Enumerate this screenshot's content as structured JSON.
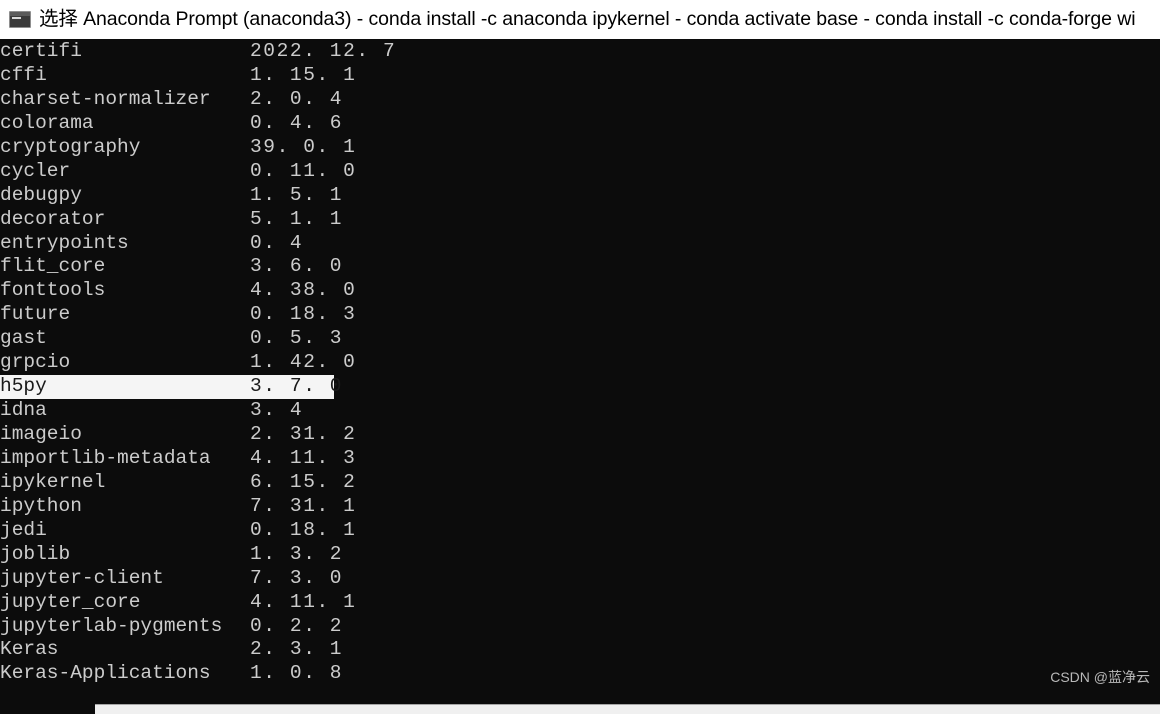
{
  "window": {
    "title": "选择 Anaconda Prompt (anaconda3) - conda  install -c anaconda ipykernel - conda  activate base - conda  install -c conda-forge wi",
    "icon": "console-icon",
    "titlebar_bg": "#ffffff",
    "titlebar_fg": "#000000"
  },
  "terminal": {
    "background": "#0c0c0c",
    "foreground": "#cccccc",
    "selection_background": "#f5f5f5",
    "selection_foreground": "#1a1a1a",
    "columns": {
      "name_header": "",
      "version_header": ""
    },
    "packages": [
      {
        "name": "certifi",
        "version": "2022. 12. 7",
        "selected": false
      },
      {
        "name": "cffi",
        "version": "1. 15. 1",
        "selected": false
      },
      {
        "name": "charset-normalizer",
        "version": "2. 0. 4",
        "selected": false
      },
      {
        "name": "colorama",
        "version": "0. 4. 6",
        "selected": false
      },
      {
        "name": "cryptography",
        "version": "39. 0. 1",
        "selected": false
      },
      {
        "name": "cycler",
        "version": "0. 11. 0",
        "selected": false
      },
      {
        "name": "debugpy",
        "version": "1. 5. 1",
        "selected": false
      },
      {
        "name": "decorator",
        "version": "5. 1. 1",
        "selected": false
      },
      {
        "name": "entrypoints",
        "version": "0. 4",
        "selected": false
      },
      {
        "name": "flit_core",
        "version": "3. 6. 0",
        "selected": false
      },
      {
        "name": "fonttools",
        "version": "4. 38. 0",
        "selected": false
      },
      {
        "name": "future",
        "version": "0. 18. 3",
        "selected": false
      },
      {
        "name": "gast",
        "version": "0. 5. 3",
        "selected": false
      },
      {
        "name": "grpcio",
        "version": "1. 42. 0",
        "selected": false
      },
      {
        "name": "h5py",
        "version": "3. 7. 0",
        "selected": true
      },
      {
        "name": "idna",
        "version": "3. 4",
        "selected": false
      },
      {
        "name": "imageio",
        "version": "2. 31. 2",
        "selected": false
      },
      {
        "name": "importlib-metadata",
        "version": "4. 11. 3",
        "selected": false
      },
      {
        "name": "ipykernel",
        "version": "6. 15. 2",
        "selected": false
      },
      {
        "name": "ipython",
        "version": "7. 31. 1",
        "selected": false
      },
      {
        "name": "jedi",
        "version": "0. 18. 1",
        "selected": false
      },
      {
        "name": "joblib",
        "version": "1. 3. 2",
        "selected": false
      },
      {
        "name": "jupyter-client",
        "version": "7. 3. 0",
        "selected": false
      },
      {
        "name": "jupyter_core",
        "version": "4. 11. 1",
        "selected": false
      },
      {
        "name": "jupyterlab-pygments",
        "version": "0. 2. 2",
        "selected": false
      },
      {
        "name": "Keras",
        "version": "2. 3. 1",
        "selected": false
      },
      {
        "name": "Keras-Applications",
        "version": "1. 0. 8",
        "selected": false
      }
    ]
  },
  "watermark": {
    "text": "CSDN @蓝净云"
  },
  "scrollbar": {
    "orientation": "horizontal",
    "track_color": "#f0f0f0",
    "thumb_color": "#cdcdcd"
  }
}
